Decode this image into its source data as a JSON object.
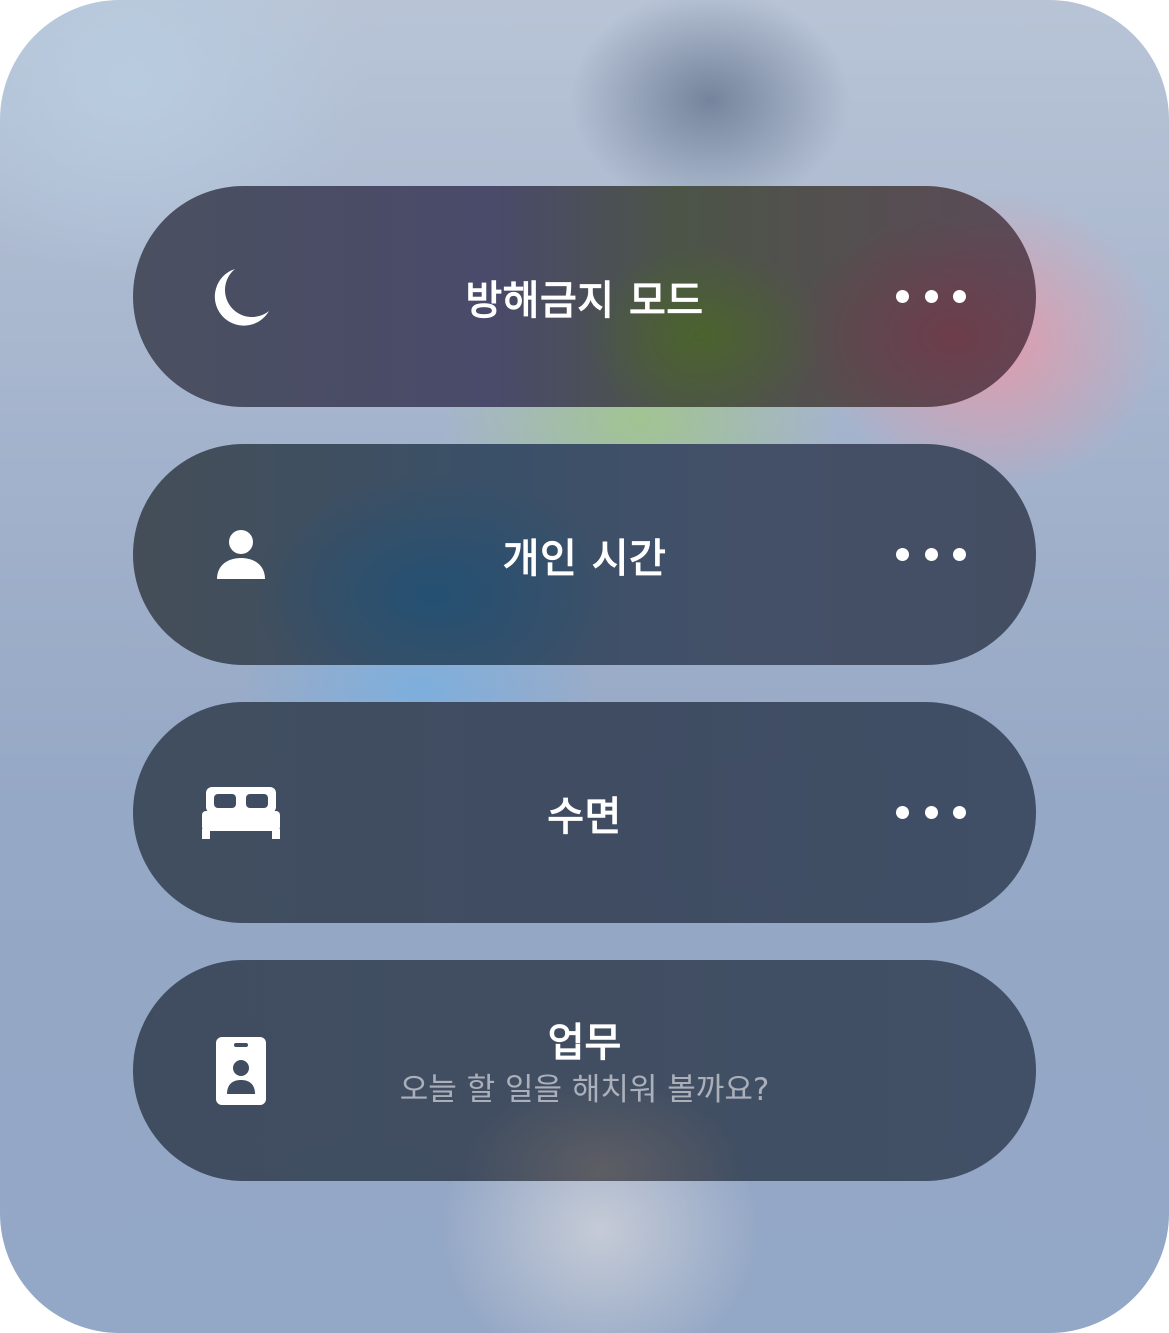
{
  "focus_modes": [
    {
      "label": "방해금지 모드",
      "icon": "moon-icon",
      "has_more": true
    },
    {
      "label": "개인 시간",
      "icon": "person-icon",
      "has_more": true
    },
    {
      "label": "수면",
      "icon": "bed-icon",
      "has_more": true
    },
    {
      "label": "업무",
      "subtitle": "오늘 할 일을 해치워 볼까요?",
      "icon": "id-badge-icon",
      "has_more": false
    }
  ],
  "colors": {
    "text": "#ffffff",
    "subtitle": "#b4bac6"
  }
}
